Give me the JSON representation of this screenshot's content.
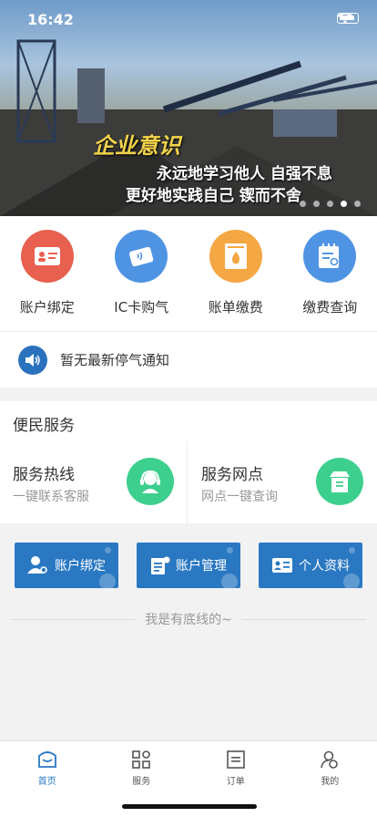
{
  "status_bar": {
    "time": "16:42"
  },
  "banner": {
    "mark": "企业意识",
    "line1": "永远地学习他人  自强不息",
    "line2": "更好地实践自己  锲而不舍"
  },
  "quick_actions": [
    {
      "label": "账户绑定",
      "color": "#e8604f",
      "icon": "id-card-icon"
    },
    {
      "label": "IC卡购气",
      "color": "#4f94e3",
      "icon": "ic-card-icon"
    },
    {
      "label": "账单缴费",
      "color": "#f5a743",
      "icon": "flame-bill-icon"
    },
    {
      "label": "缴费查询",
      "color": "#4f94e3",
      "icon": "notepad-search-icon"
    }
  ],
  "notice": {
    "text": "暂无最新停气通知"
  },
  "services": {
    "title": "便民服务",
    "hotline": {
      "name": "服务热线",
      "sub": "一键联系客服"
    },
    "outlets": {
      "name": "服务网点",
      "sub": "网点一键查询"
    }
  },
  "buttons": {
    "bind": "账户绑定",
    "manage": "账户管理",
    "profile": "个人资料"
  },
  "bottom_line": "我是有底线的~",
  "tabs": {
    "home": "首页",
    "service": "服务",
    "orders": "订单",
    "mine": "我的"
  },
  "colors": {
    "accent": "#2a78c2",
    "green": "#3dcf8e"
  }
}
